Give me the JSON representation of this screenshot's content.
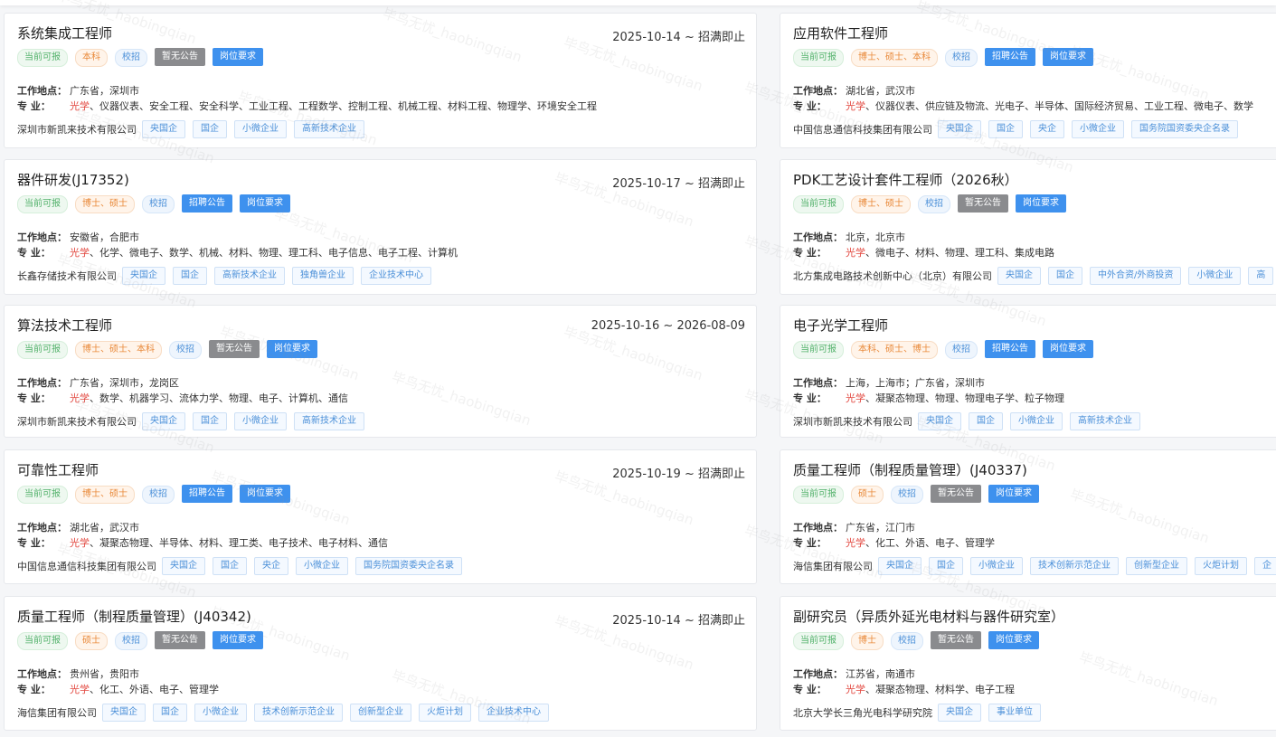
{
  "watermark": "毕鸟无忧_haobingqian",
  "date_sep": " ~ ",
  "labels": {
    "location": "工作地点：",
    "major": "专    业："
  },
  "cards": [
    {
      "title": "系统集成工程师",
      "date_start": "2025-10-14",
      "date_end": "招满即止",
      "tags": [
        {
          "text": "当前可报",
          "kind": "green"
        },
        {
          "text": "本科",
          "kind": "orange"
        },
        {
          "text": "校招",
          "kind": "blue"
        },
        {
          "text": "暂无公告",
          "kind": "gray-btn"
        },
        {
          "text": "岗位要求",
          "kind": "blue-btn"
        }
      ],
      "location": "广东省，深圳市",
      "major_highlight": "光学",
      "major_rest": "、仪器仪表、安全工程、安全科学、工业工程、工程数学、控制工程、机械工程、材料工程、物理学、环境安全工程",
      "company": "深圳市新凯来技术有限公司",
      "company_tags": [
        "央国企",
        "国企",
        "小微企业",
        "高新技术企业"
      ]
    },
    {
      "title": "应用软件工程师",
      "date_start": "",
      "date_end": "",
      "tags": [
        {
          "text": "当前可报",
          "kind": "green"
        },
        {
          "text": "博士、硕士、本科",
          "kind": "orange"
        },
        {
          "text": "校招",
          "kind": "blue"
        },
        {
          "text": "招聘公告",
          "kind": "blue-btn"
        },
        {
          "text": "岗位要求",
          "kind": "blue-btn"
        }
      ],
      "location": "湖北省，武汉市",
      "major_highlight": "光学",
      "major_rest": "、仪器仪表、供应链及物流、光电子、半导体、国际经济贸易、工业工程、微电子、数学",
      "company": "中国信息通信科技集团有限公司",
      "company_tags": [
        "央国企",
        "国企",
        "央企",
        "小微企业",
        "国务院国资委央企名录"
      ]
    },
    {
      "title": "器件研发(J17352)",
      "date_start": "2025-10-17",
      "date_end": "招满即止",
      "tags": [
        {
          "text": "当前可报",
          "kind": "green"
        },
        {
          "text": "博士、硕士",
          "kind": "orange"
        },
        {
          "text": "校招",
          "kind": "blue"
        },
        {
          "text": "招聘公告",
          "kind": "blue-btn"
        },
        {
          "text": "岗位要求",
          "kind": "blue-btn"
        }
      ],
      "location": "安徽省，合肥市",
      "major_highlight": "光学",
      "major_rest": "、化学、微电子、数学、机械、材料、物理、理工科、电子信息、电子工程、计算机",
      "company": "长鑫存储技术有限公司",
      "company_tags": [
        "央国企",
        "国企",
        "高新技术企业",
        "独角兽企业",
        "企业技术中心"
      ]
    },
    {
      "title": "PDK工艺设计套件工程师（2026秋）",
      "date_start": "",
      "date_end": "",
      "tags": [
        {
          "text": "当前可报",
          "kind": "green"
        },
        {
          "text": "博士、硕士",
          "kind": "orange"
        },
        {
          "text": "校招",
          "kind": "blue"
        },
        {
          "text": "暂无公告",
          "kind": "gray-btn"
        },
        {
          "text": "岗位要求",
          "kind": "blue-btn"
        }
      ],
      "location": "北京，北京市",
      "major_highlight": "光学",
      "major_rest": "、微电子、材料、物理、理工科、集成电路",
      "company": "北方集成电路技术创新中心（北京）有限公司",
      "company_tags": [
        "央国企",
        "国企",
        "中外合资/外商投资",
        "小微企业",
        "高"
      ]
    },
    {
      "title": "算法技术工程师",
      "date_start": "2025-10-16",
      "date_end": "2026-08-09",
      "tags": [
        {
          "text": "当前可报",
          "kind": "green"
        },
        {
          "text": "博士、硕士、本科",
          "kind": "orange"
        },
        {
          "text": "校招",
          "kind": "blue"
        },
        {
          "text": "暂无公告",
          "kind": "gray-btn"
        },
        {
          "text": "岗位要求",
          "kind": "blue-btn"
        }
      ],
      "location": "广东省，深圳市，龙岗区",
      "major_highlight": "光学",
      "major_rest": "、数学、机器学习、流体力学、物理、电子、计算机、通信",
      "company": "深圳市新凯来技术有限公司",
      "company_tags": [
        "央国企",
        "国企",
        "小微企业",
        "高新技术企业"
      ]
    },
    {
      "title": "电子光学工程师",
      "date_start": "",
      "date_end": "",
      "tags": [
        {
          "text": "当前可报",
          "kind": "green"
        },
        {
          "text": "本科、硕士、博士",
          "kind": "orange"
        },
        {
          "text": "校招",
          "kind": "blue"
        },
        {
          "text": "招聘公告",
          "kind": "blue-btn"
        },
        {
          "text": "岗位要求",
          "kind": "blue-btn"
        }
      ],
      "location": "上海，上海市；广东省，深圳市",
      "major_highlight": "光学",
      "major_rest": "、凝聚态物理、物理、物理电子学、粒子物理",
      "company": "深圳市新凯来技术有限公司",
      "company_tags": [
        "央国企",
        "国企",
        "小微企业",
        "高新技术企业"
      ]
    },
    {
      "title": "可靠性工程师",
      "date_start": "2025-10-19",
      "date_end": "招满即止",
      "tags": [
        {
          "text": "当前可报",
          "kind": "green"
        },
        {
          "text": "博士、硕士",
          "kind": "orange"
        },
        {
          "text": "校招",
          "kind": "blue"
        },
        {
          "text": "招聘公告",
          "kind": "blue-btn"
        },
        {
          "text": "岗位要求",
          "kind": "blue-btn"
        }
      ],
      "location": "湖北省，武汉市",
      "major_highlight": "光学",
      "major_rest": "、凝聚态物理、半导体、材料、理工类、电子技术、电子材料、通信",
      "company": "中国信息通信科技集团有限公司",
      "company_tags": [
        "央国企",
        "国企",
        "央企",
        "小微企业",
        "国务院国资委央企名录"
      ]
    },
    {
      "title": "质量工程师（制程质量管理）(J40337)",
      "date_start": "",
      "date_end": "",
      "tags": [
        {
          "text": "当前可报",
          "kind": "green"
        },
        {
          "text": "硕士",
          "kind": "orange"
        },
        {
          "text": "校招",
          "kind": "blue"
        },
        {
          "text": "暂无公告",
          "kind": "gray-btn"
        },
        {
          "text": "岗位要求",
          "kind": "blue-btn"
        }
      ],
      "location": "广东省，江门市",
      "major_highlight": "光学",
      "major_rest": "、化工、外语、电子、管理学",
      "company": "海信集团有限公司",
      "company_tags": [
        "央国企",
        "国企",
        "小微企业",
        "技术创新示范企业",
        "创新型企业",
        "火炬计划",
        "企"
      ]
    },
    {
      "title": "质量工程师（制程质量管理）(J40342)",
      "date_start": "2025-10-14",
      "date_end": "招满即止",
      "tags": [
        {
          "text": "当前可报",
          "kind": "green"
        },
        {
          "text": "硕士",
          "kind": "orange"
        },
        {
          "text": "校招",
          "kind": "blue"
        },
        {
          "text": "暂无公告",
          "kind": "gray-btn"
        },
        {
          "text": "岗位要求",
          "kind": "blue-btn"
        }
      ],
      "location": "贵州省，贵阳市",
      "major_highlight": "光学",
      "major_rest": "、化工、外语、电子、管理学",
      "company": "海信集团有限公司",
      "company_tags": [
        "央国企",
        "国企",
        "小微企业",
        "技术创新示范企业",
        "创新型企业",
        "火炬计划",
        "企业技术中心"
      ]
    },
    {
      "title": "副研究员（异质外延光电材料与器件研究室）",
      "date_start": "",
      "date_end": "",
      "tags": [
        {
          "text": "当前可报",
          "kind": "green"
        },
        {
          "text": "博士",
          "kind": "orange"
        },
        {
          "text": "校招",
          "kind": "blue"
        },
        {
          "text": "暂无公告",
          "kind": "gray-btn"
        },
        {
          "text": "岗位要求",
          "kind": "blue-btn"
        }
      ],
      "location": "江苏省，南通市",
      "major_highlight": "光学",
      "major_rest": "、凝聚态物理、材料学、电子工程",
      "company": "北京大学长三角光电科学研究院",
      "company_tags": [
        "央国企",
        "事业单位"
      ]
    }
  ]
}
